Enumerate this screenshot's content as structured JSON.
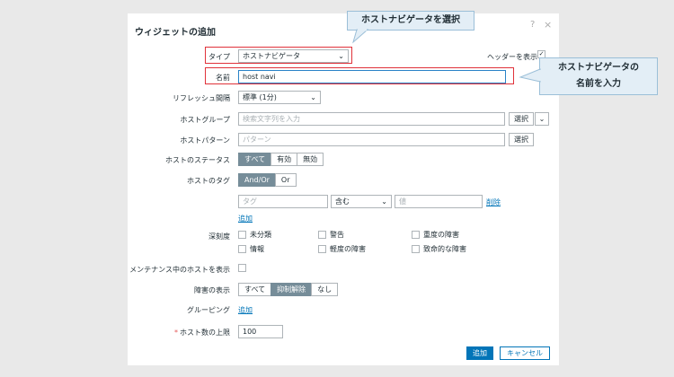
{
  "dialog": {
    "title": "ウィジェットの追加",
    "help_glyph": "?",
    "close_glyph": "×"
  },
  "fields": {
    "type_label": "タイプ",
    "type_value": "ホストナビゲータ",
    "header_label": "ヘッダーを表示",
    "header_checked": true,
    "name_label": "名前",
    "name_value": "host navi",
    "refresh_label": "リフレッシュ間隔",
    "refresh_value": "標準 (1分)",
    "hostgroups_label": "ホストグループ",
    "hostgroups_placeholder": "検索文字列を入力",
    "select_label": "選択",
    "hostpattern_label": "ホストパターン",
    "hostpattern_placeholder": "パターン",
    "hoststatus_label": "ホストのステータス",
    "hoststatus_options": [
      "すべて",
      "有効",
      "無効"
    ],
    "hoststatus_selected": "すべて",
    "hosttags_label": "ホストのタグ",
    "hosttags_options": [
      "And/Or",
      "Or"
    ],
    "hosttags_selected": "And/Or",
    "tag_placeholder": "タグ",
    "tag_operator": "含む",
    "tag_value_placeholder": "値",
    "remove_label": "削除",
    "add_label": "追加",
    "severity_label": "深刻度",
    "severities": [
      "未分類",
      "警告",
      "重度の障害",
      "情報",
      "軽度の障害",
      "致命的な障害"
    ],
    "maintenance_label": "メンテナンス中のホストを表示",
    "problems_label": "障害の表示",
    "problems_options": [
      "すべて",
      "抑制解除",
      "なし"
    ],
    "problems_selected": "抑制解除",
    "grouping_label": "グルーピング",
    "grouping_add": "追加",
    "limit_label": "ホスト数の上限",
    "limit_required_mark": "*",
    "limit_value": "100"
  },
  "footer": {
    "add_button": "追加",
    "cancel_button": "キャンセル"
  },
  "callouts": {
    "select_type": "ホストナビゲータを選択",
    "enter_name_line1": "ホストナビゲータの",
    "enter_name_line2": "名前を入力"
  },
  "colors": {
    "accent": "#0275b8",
    "segment_active": "#768d99",
    "highlight": "#e0323a",
    "callout_bg": "#e3eef6"
  }
}
